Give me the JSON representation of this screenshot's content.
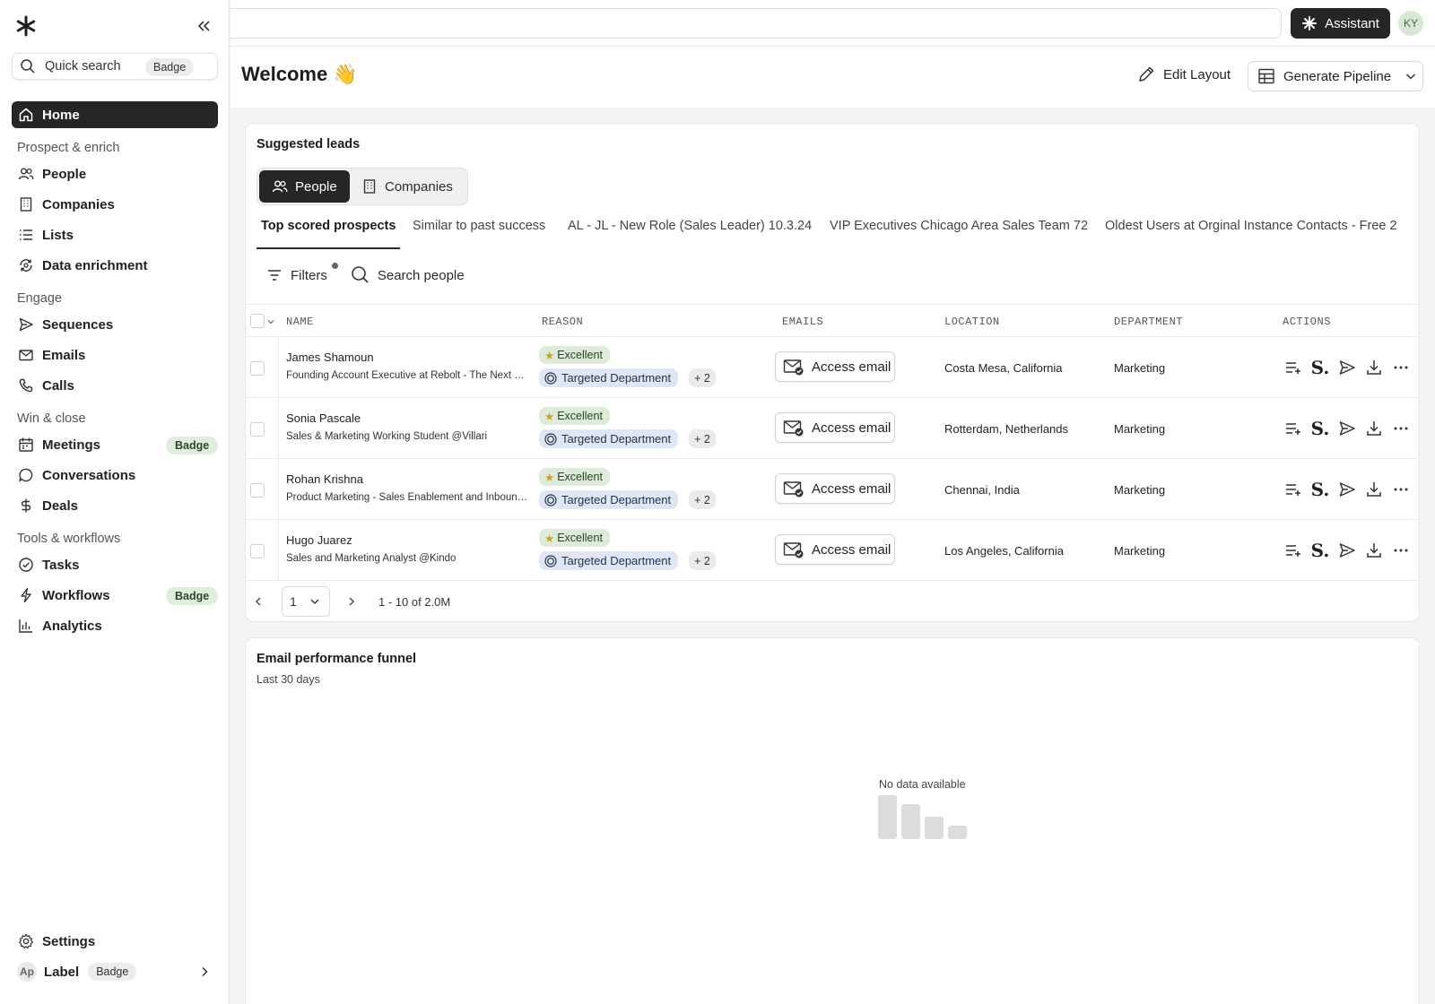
{
  "sidebar": {
    "quick_search": {
      "label": "Quick search",
      "badge": "Badge"
    },
    "home": "Home",
    "sections": {
      "prospect": "Prospect & enrich",
      "engage": "Engage",
      "win": "Win & close",
      "tools": "Tools & workflows"
    },
    "items": {
      "people": "People",
      "companies": "Companies",
      "lists": "Lists",
      "data_enrichment": "Data enrichment",
      "sequences": "Sequences",
      "emails": "Emails",
      "calls": "Calls",
      "meetings": "Meetings",
      "conversations": "Conversations",
      "deals": "Deals",
      "tasks": "Tasks",
      "workflows": "Workflows",
      "analytics": "Analytics",
      "settings": "Settings"
    },
    "badges": {
      "meetings": "Badge",
      "workflows": "Badge"
    },
    "footer": {
      "avatar": "Ap",
      "label": "Label",
      "badge": "Badge"
    }
  },
  "topbar": {
    "assistant": "Assistant",
    "user_initials": "KY"
  },
  "header": {
    "title": "Welcome 👋",
    "edit_layout": "Edit Layout",
    "generate_pipeline": "Generate Pipeline"
  },
  "leads": {
    "title": "Suggested leads",
    "segments": {
      "people": "People",
      "companies": "Companies"
    },
    "tabs": [
      "Top scored prospects",
      "Similar to past success",
      "AL - JL - New Role (Sales Leader) 10.3.24",
      "VIP Executives Chicago Area Sales Team 72",
      "Oldest Users at Orginal Instance Contacts - Free 2"
    ],
    "filters": "Filters",
    "search": "Search people",
    "columns": {
      "name": "NAME",
      "reason": "REASON",
      "emails": "EMAILS",
      "location": "LOCATION",
      "department": "DEPARTMENT",
      "actions": "ACTIONS"
    },
    "rows": [
      {
        "name": "James Shamoun",
        "title": "Founding Account Executive at Rebolt - The Next …",
        "score": "Excellent",
        "reason": "Targeted Department",
        "more": "+ 2",
        "email_btn": "Access email",
        "location": "Costa Mesa, California",
        "department": "Marketing"
      },
      {
        "name": "Sonia Pascale",
        "title": "Sales & Marketing Working Student @Villari",
        "score": "Excellent",
        "reason": "Targeted Department",
        "more": "+ 2",
        "email_btn": "Access email",
        "location": "Rotterdam, Netherlands",
        "department": "Marketing"
      },
      {
        "name": "Rohan Krishna",
        "title": "Product Marketing - Sales Enablement and Inbound…",
        "score": "Excellent",
        "reason": "Targeted Department",
        "more": "+ 2",
        "email_btn": "Access email",
        "location": "Chennai, India",
        "department": "Marketing"
      },
      {
        "name": "Hugo Juarez",
        "title": "Sales and Marketing Analyst @Kindo",
        "score": "Excellent",
        "reason": "Targeted Department",
        "more": "+ 2",
        "email_btn": "Access email",
        "location": "Los Angeles, California",
        "department": "Marketing"
      }
    ],
    "pager": {
      "page": "1",
      "range": "1 - 10 of 2.0M"
    }
  },
  "funnel": {
    "title": "Email performance funnel",
    "subtitle": "Last 30 days",
    "empty": "No data available"
  },
  "colors": {
    "primary_dark": "#262626",
    "excellent_bg": "#dcecd8",
    "department_bg": "#dfe6f6",
    "badge_green": "#dfeedd"
  }
}
